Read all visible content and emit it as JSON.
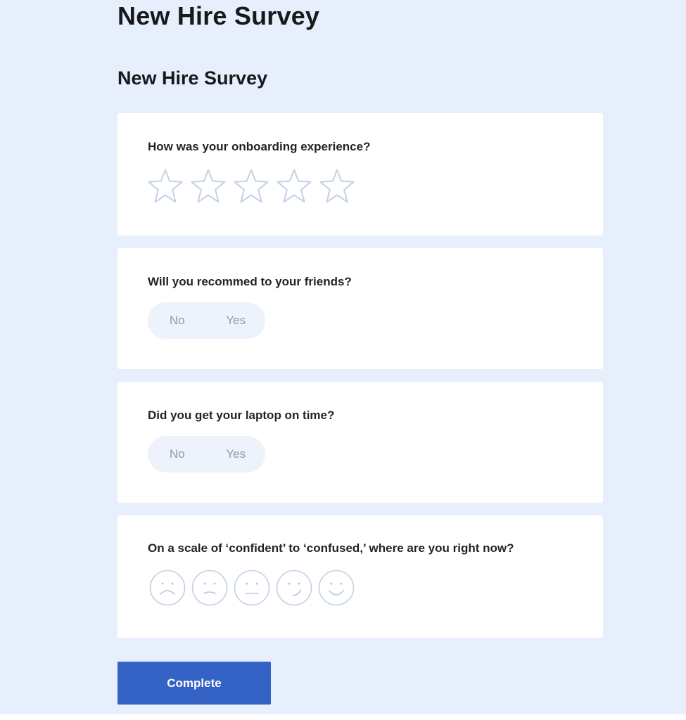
{
  "page": {
    "title": "New Hire Survey"
  },
  "survey": {
    "title": "New Hire Survey",
    "questions": [
      {
        "text": "How was your onboarding experience?",
        "type": "rating",
        "icon": "star-icon",
        "max": 5,
        "selected": 0
      },
      {
        "text": "Will you recommed to your friends?",
        "type": "boolean",
        "options": [
          "No",
          "Yes"
        ],
        "selected": null
      },
      {
        "text": "Did you get your laptop on time?",
        "type": "boolean",
        "options": [
          "No",
          "Yes"
        ],
        "selected": null
      },
      {
        "text": "On a scale of ‘confident’ to ‘confused,’ where are you right now?",
        "type": "emotion-rating",
        "icons": [
          "frown-face-icon",
          "sad-face-icon",
          "neutral-face-icon",
          "smirk-face-icon",
          "smile-face-icon"
        ],
        "selected": null
      }
    ],
    "complete_label": "Complete"
  },
  "colors": {
    "page_background": "#e8effc",
    "card_background": "#ffffff",
    "icon_outline": "#c3d0e6",
    "toggle_background": "#eef2fb",
    "toggle_text": "#8d9ab5",
    "primary_button": "#3463c5"
  }
}
